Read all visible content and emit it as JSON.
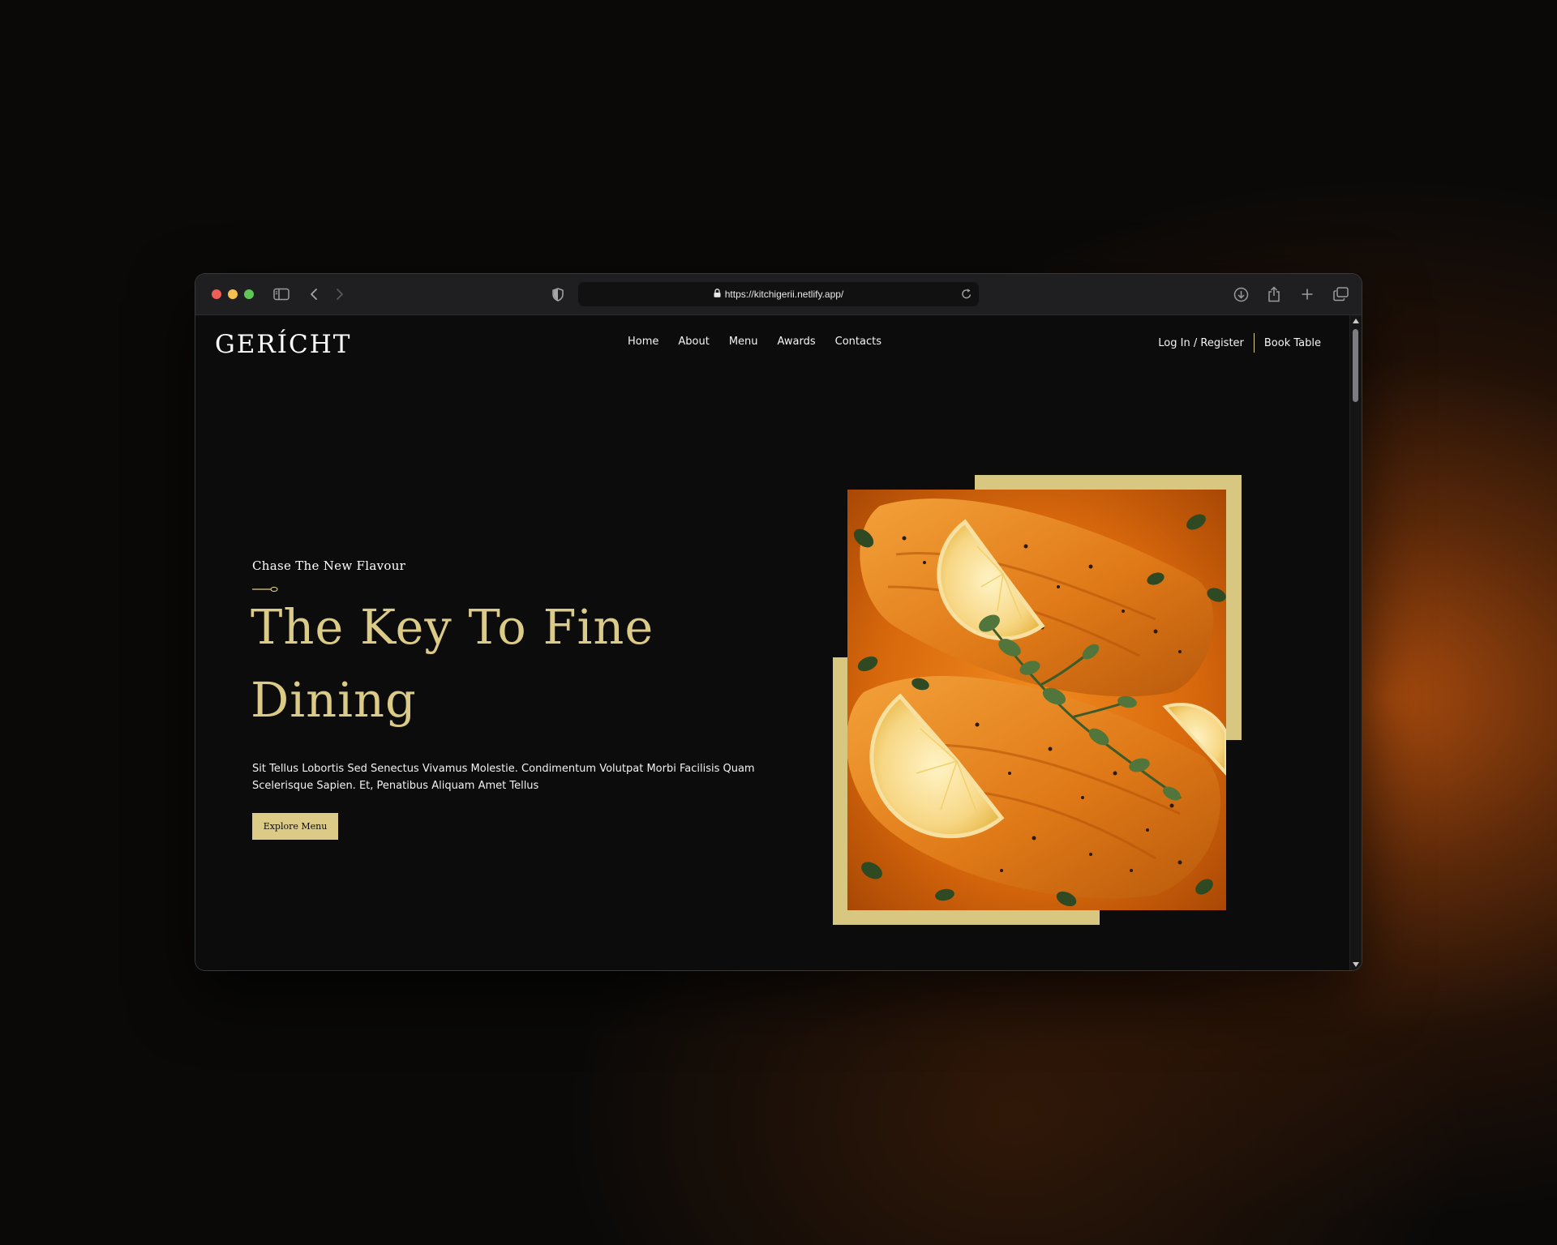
{
  "browser": {
    "url": "https://kitchigerii.netlify.app/",
    "icons": [
      "sidebar-icon",
      "back-icon",
      "forward-icon",
      "shield-icon",
      "lock-icon",
      "reload-icon",
      "download-icon",
      "share-icon",
      "new-tab-icon",
      "tabs-overview-icon"
    ]
  },
  "site": {
    "logo": "GERÍCHT",
    "nav": [
      "Home",
      "About",
      "Menu",
      "Awards",
      "Contacts"
    ],
    "login": "Log In / Register",
    "book": "Book Table"
  },
  "hero": {
    "subtitle": "Chase The New Flavour",
    "title": "The Key To Fine Dining",
    "description": "Sit Tellus Lobortis Sed Senectus Vivamus Molestie. Condimentum Volutpat Morbi Facilisis Quam Scelerisque Sapien. Et, Penatibus Aliquam Amet Tellus",
    "cta": "Explore Menu",
    "image": "salmon-with-lemon-and-herbs"
  },
  "colors": {
    "gold": "#dcca87",
    "background": "#0c0c0c",
    "accent_orange": "#d46a0e"
  }
}
